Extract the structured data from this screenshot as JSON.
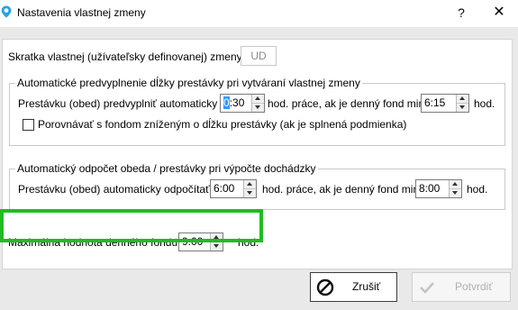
{
  "window": {
    "title": "Nastavenia vlastnej zmeny",
    "help_label": "?",
    "close_label": "✕"
  },
  "shortcut": {
    "label": "Skratka vlastnej (užívateľsky definovanej) zmeny:",
    "value": "UD"
  },
  "auto_fill_group": {
    "title": "Automatické predvyplnenie dĺžky prestávky pri vytváraní vlastnej zmeny",
    "row_label": "Prestávku (obed) predvyplniť automaticky na",
    "break_value_selected": "0",
    "break_value_rest": ":30",
    "mid_label": "hod. práce, ak je denný fond min.",
    "fund_value": "6:15",
    "unit_label": "hod.",
    "checkbox_label": "Porovnávať s fondom zníženým o dĺžku prestávky (ak je splnená podmienka)",
    "checkbox_checked": false
  },
  "auto_deduct_group": {
    "title": "Automatický odpočet obeda / prestávky pri výpočte dochádzky",
    "row_label": "Prestávku (obed) automaticky odpočítať po",
    "after_value": "6:00",
    "mid_label": "hod. práce, ak je denný fond min.",
    "fund_value": "8:00",
    "unit_label": "hod."
  },
  "max_fund": {
    "label": "Maximálna hodnota denného fondu:",
    "value": "9:00",
    "unit_label": "hod."
  },
  "buttons": {
    "cancel_label": "Zrušiť",
    "confirm_label": "Potvrdiť"
  },
  "colors": {
    "highlight_border": "#22bb22",
    "selection": "#3399ff",
    "dialog_background": "#e9e9e9"
  },
  "icons": {
    "app": "location-pin-icon",
    "cancel": "cancel-circle-icon",
    "confirm": "checkmark-icon"
  }
}
